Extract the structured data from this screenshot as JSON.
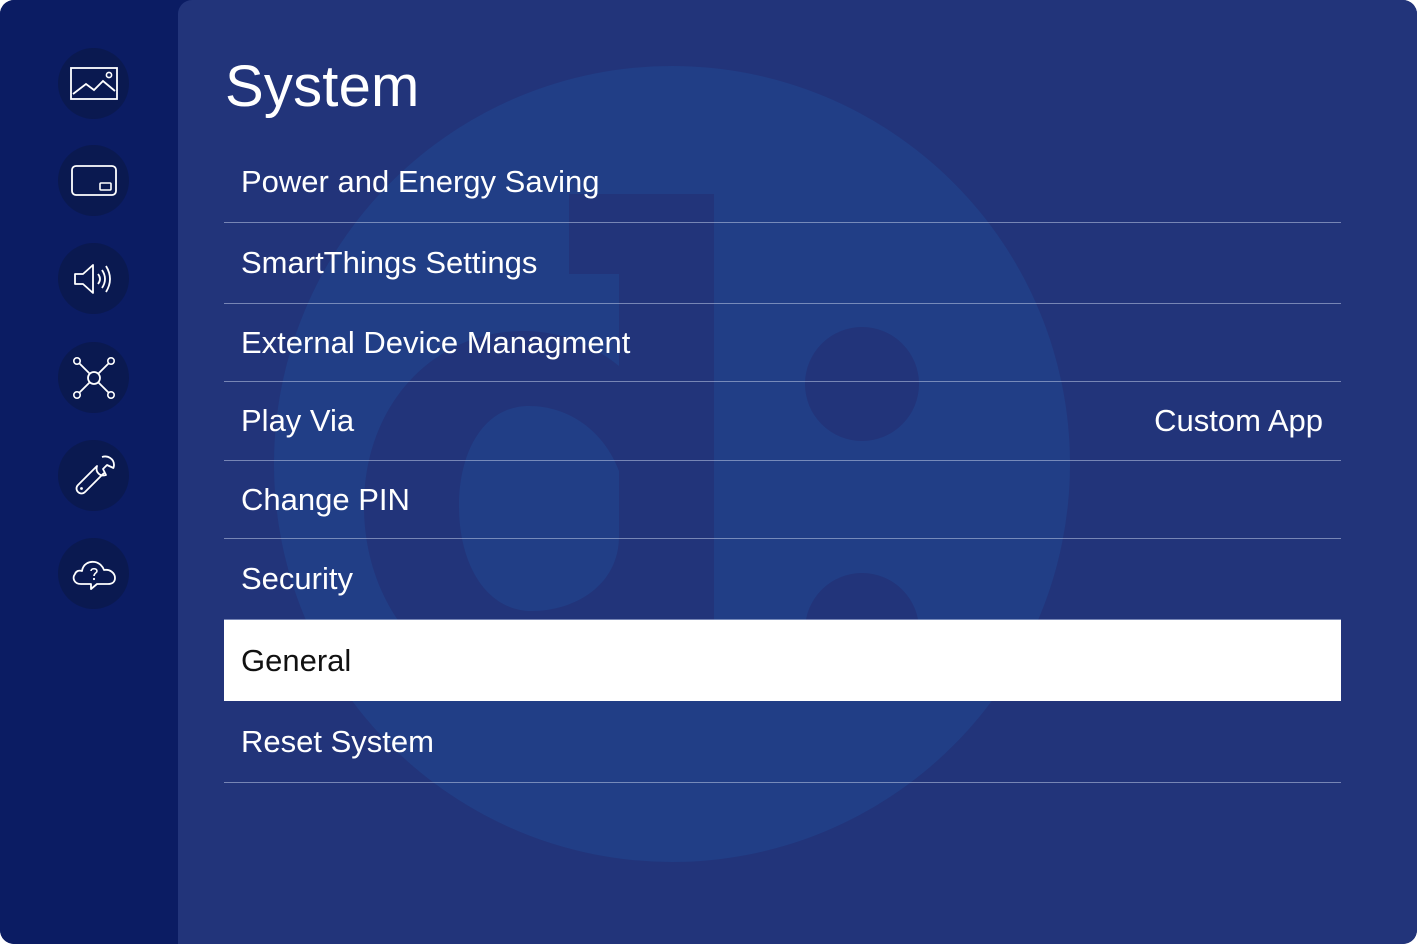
{
  "page": {
    "title": "System"
  },
  "sidebar": {
    "items": [
      {
        "icon": "picture-icon"
      },
      {
        "icon": "picture-in-picture-icon"
      },
      {
        "icon": "sound-icon"
      },
      {
        "icon": "network-icon"
      },
      {
        "icon": "wrench-icon"
      },
      {
        "icon": "cloud-help-icon"
      }
    ]
  },
  "menu": {
    "items": [
      {
        "label": "Power and Energy Saving",
        "value": ""
      },
      {
        "label": "SmartThings Settings",
        "value": ""
      },
      {
        "label": "External Device Managment",
        "value": ""
      },
      {
        "label": "Play Via",
        "value": "Custom App"
      },
      {
        "label": "Change PIN",
        "value": ""
      },
      {
        "label": "Security",
        "value": ""
      },
      {
        "label": "General",
        "value": "",
        "selected": true
      },
      {
        "label": "Reset System",
        "value": ""
      }
    ]
  },
  "colors": {
    "sidebar_bg": "#0b1c63",
    "main_bg": "#22347a",
    "selected_bg": "#ffffff",
    "text": "#ffffff"
  }
}
